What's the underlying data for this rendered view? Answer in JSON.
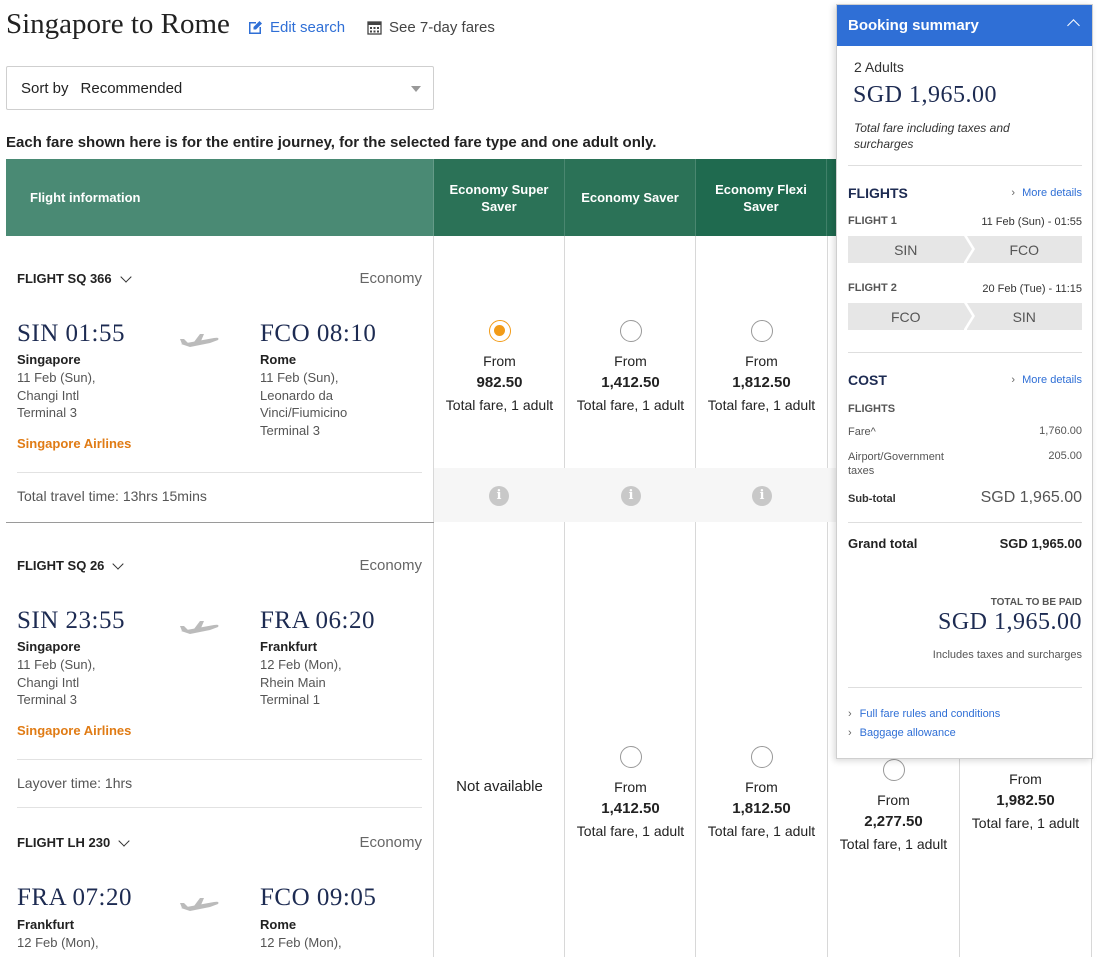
{
  "header": {
    "title": "Singapore to Rome",
    "edit_search": "Edit search",
    "seven_day": "See 7-day fares"
  },
  "sort": {
    "label": "Sort by",
    "value": "Recommended"
  },
  "note": "Each fare shown here is for the entire journey, for the selected fare type and one adult only.",
  "table": {
    "columns": {
      "info": "Flight information",
      "c1": "Economy Super Saver",
      "c2": "Economy Saver",
      "c3": "Economy Flexi Saver"
    }
  },
  "flights": [
    {
      "head": "FLIGHT SQ 366",
      "cabin": "Economy",
      "dep_time": "SIN 01:55",
      "dep_city": "Singapore",
      "dep_detail": [
        "11 Feb (Sun),",
        "Changi Intl",
        "Terminal 3"
      ],
      "arr_time": "FCO 08:10",
      "arr_city": "Rome",
      "arr_detail": [
        "11 Feb (Sun),",
        "Leonardo da",
        "Vinci/Fiumicino",
        "Terminal 3"
      ],
      "airline": "Singapore Airlines",
      "total_time": "Total travel time: 13hrs 15mins",
      "fares": [
        {
          "from": "From",
          "amount": "982.50",
          "label": "Total fare, 1 adult"
        },
        {
          "from": "From",
          "amount": "1,412.50",
          "label": "Total fare, 1 adult"
        },
        {
          "from": "From",
          "amount": "1,812.50",
          "label": "Total fare, 1 adult"
        }
      ]
    },
    {
      "head": "FLIGHT SQ 26",
      "cabin": "Economy",
      "dep_time": "SIN 23:55",
      "dep_city": "Singapore",
      "dep_detail": [
        "11 Feb (Sun),",
        "Changi Intl",
        "Terminal 3"
      ],
      "arr_time": "FRA 06:20",
      "arr_city": "Frankfurt",
      "arr_detail": [
        "12 Feb (Mon),",
        "Rhein Main",
        "Terminal 1"
      ],
      "airline": "Singapore Airlines",
      "layover": "Layover time: 1hrs"
    },
    {
      "head": "FLIGHT LH 230",
      "cabin": "Economy",
      "dep_time": "FRA 07:20",
      "dep_city": "Frankfurt",
      "dep_detail": [
        "12 Feb (Mon),"
      ],
      "arr_time": "FCO 09:05",
      "arr_city": "Rome",
      "arr_detail": [
        "12 Feb (Mon),"
      ]
    }
  ],
  "option2_fares": {
    "not_available": "Not available",
    "c2": {
      "from": "From",
      "amount": "1,412.50",
      "label": "Total fare, 1 adult"
    },
    "c3": {
      "from": "From",
      "amount": "1,812.50",
      "label": "Total fare, 1 adult"
    },
    "c4": {
      "from": "From",
      "amount": "2,277.50",
      "label": "Total fare, 1 adult"
    },
    "c5": {
      "from": "From",
      "amount": "1,982.50",
      "label": "Total fare, 1 adult"
    }
  },
  "summary": {
    "title": "Booking summary",
    "pax": "2 Adults",
    "total": "SGD 1,965.00",
    "total_note": "Total fare including taxes and surcharges",
    "flights_title": "FLIGHTS",
    "more_details": "More details",
    "flight1_label": "FLIGHT 1",
    "flight1_date": "11 Feb (Sun) - 01:55",
    "flight1_from": "SIN",
    "flight1_to": "FCO",
    "flight2_label": "FLIGHT 2",
    "flight2_date": "20 Feb (Tue) - 11:15",
    "flight2_from": "FCO",
    "flight2_to": "SIN",
    "cost_title": "COST",
    "cost_flights": "FLIGHTS",
    "fare_label": "Fare^",
    "fare_value": "1,760.00",
    "tax_label": "Airport/Government taxes",
    "tax_value": "205.00",
    "subtotal_label": "Sub-total",
    "subtotal_value": "SGD 1,965.00",
    "grand_label": "Grand total",
    "grand_value": "SGD 1,965.00",
    "to_pay_label": "TOTAL TO BE PAID",
    "to_pay_value": "SGD 1,965.00",
    "includes": "Includes taxes and surcharges",
    "link_rules": "Full fare rules and conditions",
    "link_baggage": "Baggage allowance"
  },
  "colors": {
    "accent": "#2f6fd6",
    "header_green": "#2b7257",
    "airline_orange": "#e07b14",
    "selected_radio": "#f29b17"
  }
}
